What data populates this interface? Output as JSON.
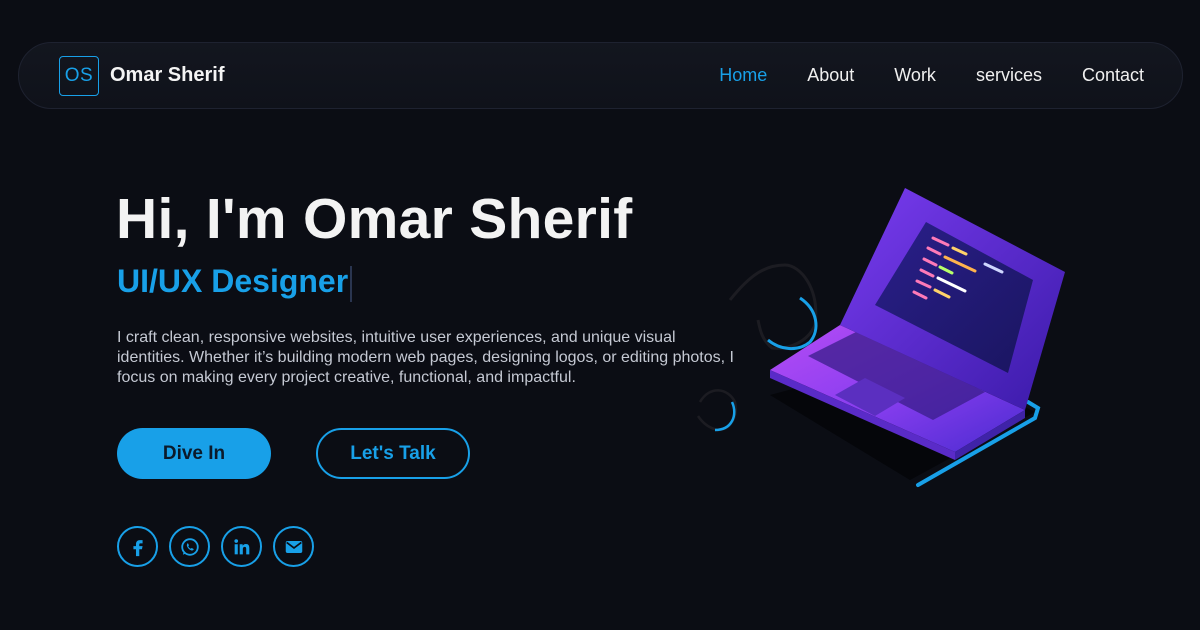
{
  "nav": {
    "logo_text": "OS",
    "brand_name": "Omar Sherif",
    "links": [
      {
        "label": "Home",
        "active": true
      },
      {
        "label": "About",
        "active": false
      },
      {
        "label": "Work",
        "active": false
      },
      {
        "label": "services",
        "active": false
      },
      {
        "label": "Contact",
        "active": false
      }
    ]
  },
  "hero": {
    "title": "Hi, I'm Omar Sherif",
    "role": "UI/UX Designer",
    "intro": "I craft clean, responsive websites, intuitive user experiences, and unique visual identities. Whether it’s building modern web pages, designing logos, or editing photos, I focus on making every project creative, functional, and impactful.",
    "primary_button": "Dive In",
    "secondary_button": "Let's Talk"
  },
  "socials": [
    "facebook-icon",
    "whatsapp-icon",
    "linkedin-icon",
    "email-icon"
  ],
  "colors": {
    "background": "#0b0d14",
    "accent": "#18a0e8",
    "text": "#f2f2f2",
    "muted": "#c5c9d3"
  }
}
